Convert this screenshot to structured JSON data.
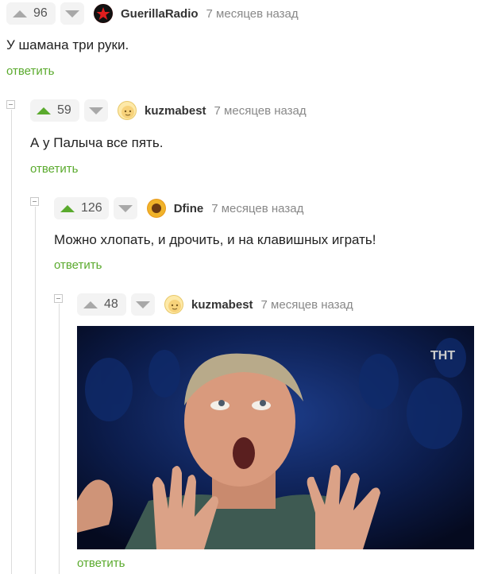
{
  "comments": [
    {
      "votes": "96",
      "author": "GuerillaRadio",
      "time": "7 месяцев назад",
      "text": "У шамана три руки.",
      "reply": "ответить"
    },
    {
      "votes": "59",
      "author": "kuzmabest",
      "time": "7 месяцев назад",
      "text": "А у Палыча все пять.",
      "reply": "ответить"
    },
    {
      "votes": "126",
      "author": "Dfine",
      "time": "7 месяцев назад",
      "text": "Можно хлопать, и дрочить, и на клавишных играть!",
      "reply": "ответить"
    },
    {
      "votes": "48",
      "author": "kuzmabest",
      "time": "7 месяцев назад",
      "reply": "ответить",
      "media_watermark": "ТНТ"
    }
  ],
  "colors": {
    "accent": "#5aaa2d",
    "vote_bg": "#f3f3f3",
    "muted": "#888888"
  },
  "icons": {
    "upvote": "triangle-up-icon",
    "downvote": "triangle-down-icon",
    "collapse": "minus-box-icon"
  }
}
